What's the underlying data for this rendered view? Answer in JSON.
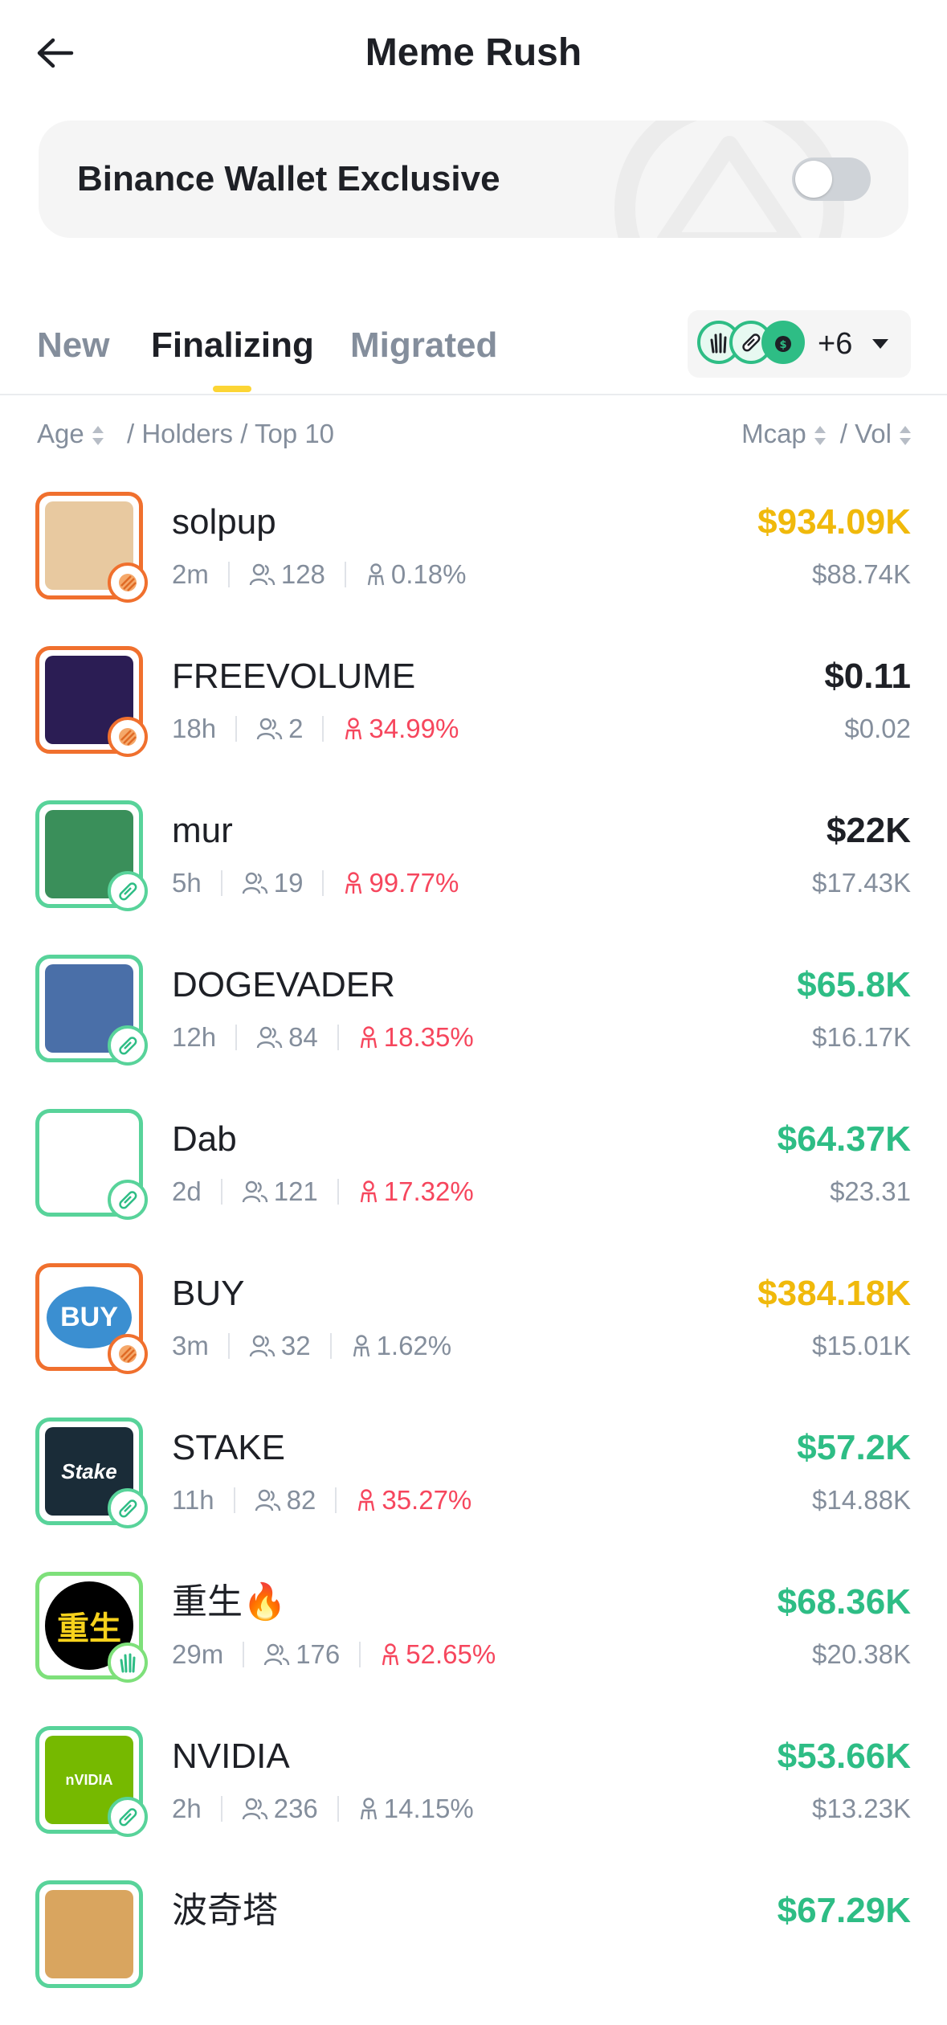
{
  "header": {
    "title": "Meme Rush",
    "back_icon": "arrow-left-icon"
  },
  "exclusive": {
    "label": "Binance Wallet Exclusive",
    "toggle_on": false
  },
  "tabs": [
    {
      "label": "New",
      "active": false
    },
    {
      "label": "Finalizing",
      "active": true
    },
    {
      "label": "Migrated",
      "active": false
    }
  ],
  "filter": {
    "icons": [
      "wave-hand-icon",
      "pill-icon",
      "money-bag-icon"
    ],
    "extra_count": "+6"
  },
  "columns": {
    "age": "Age",
    "holders": "/ Holders / Top 10",
    "mcap": "Mcap",
    "vol": "/ Vol"
  },
  "colors": {
    "accent_yellow": "#fcd535",
    "green": "#2ebd85",
    "gold": "#f0b90b",
    "red": "#f6465d",
    "orange_frame": "#f0702e",
    "green_frame": "#58d39a",
    "lime_frame": "#7ee07a"
  },
  "tokens": [
    {
      "name": "solpup",
      "age": "2m",
      "holders": "128",
      "top10": "0.18%",
      "top10_red": false,
      "mcap": "$934.09K",
      "mcap_color": "#f0b90b",
      "vol": "$88.74K",
      "frame": "orange",
      "badge": "stripes-icon",
      "avatar_icon": "dog-avatar-icon",
      "avatar_bg": "#e8c9a0"
    },
    {
      "name": "FREEVOLUME",
      "age": "18h",
      "holders": "2",
      "top10": "34.99%",
      "top10_red": true,
      "mcap": "$0.11",
      "mcap_color": "#1e2026",
      "vol": "$0.02",
      "frame": "orange",
      "badge": "stripes-icon",
      "avatar_icon": "coin-avatar-icon",
      "avatar_bg": "#2b1d54"
    },
    {
      "name": "mur",
      "age": "5h",
      "holders": "19",
      "top10": "99.77%",
      "top10_red": true,
      "mcap": "$22K",
      "mcap_color": "#1e2026",
      "vol": "$17.43K",
      "frame": "green",
      "badge": "pill-icon",
      "avatar_icon": "cat-avatar-icon",
      "avatar_bg": "#3a8f5a"
    },
    {
      "name": "DOGEVADER",
      "age": "12h",
      "holders": "84",
      "top10": "18.35%",
      "top10_red": true,
      "mcap": "$65.8K",
      "mcap_color": "#2ebd85",
      "vol": "$16.17K",
      "frame": "green",
      "badge": "pill-icon",
      "avatar_icon": "saber-avatar-icon",
      "avatar_bg": "#4a6fa8"
    },
    {
      "name": "Dab",
      "age": "2d",
      "holders": "121",
      "top10": "17.32%",
      "top10_red": true,
      "mcap": "$64.37K",
      "mcap_color": "#2ebd85",
      "vol": "$23.31",
      "frame": "green",
      "badge": "pill-icon",
      "avatar_icon": "dab-avatar-icon",
      "avatar_bg": "#ffffff"
    },
    {
      "name": "BUY",
      "age": "3m",
      "holders": "32",
      "top10": "1.62%",
      "top10_red": false,
      "mcap": "$384.18K",
      "mcap_color": "#f0b90b",
      "vol": "$15.01K",
      "frame": "orange",
      "badge": "stripes-icon",
      "avatar_icon": "buy-button-avatar-icon",
      "avatar_bg": "#ffffff",
      "avatar_text": "BUY"
    },
    {
      "name": "STAKE",
      "age": "11h",
      "holders": "82",
      "top10": "35.27%",
      "top10_red": true,
      "mcap": "$57.2K",
      "mcap_color": "#2ebd85",
      "vol": "$14.88K",
      "frame": "green",
      "badge": "pill-icon",
      "avatar_icon": "stake-logo-avatar-icon",
      "avatar_bg": "#1a2c38",
      "avatar_text": "Stake"
    },
    {
      "name": "重生🔥",
      "age": "29m",
      "holders": "176",
      "top10": "52.65%",
      "top10_red": true,
      "mcap": "$68.36K",
      "mcap_color": "#2ebd85",
      "vol": "$20.38K",
      "frame": "lime",
      "badge": "wave-hand-icon",
      "avatar_icon": "rebirth-avatar-icon",
      "avatar_bg": "#000000",
      "avatar_text": "重生"
    },
    {
      "name": "NVIDIA",
      "age": "2h",
      "holders": "236",
      "top10": "14.15%",
      "top10_red": false,
      "mcap": "$53.66K",
      "mcap_color": "#2ebd85",
      "vol": "$13.23K",
      "frame": "green",
      "badge": "pill-icon",
      "avatar_icon": "nvidia-logo-avatar-icon",
      "avatar_bg": "#76b900",
      "avatar_text": "nVIDIA"
    },
    {
      "name": "波奇塔",
      "age": "",
      "holders": "",
      "top10": "",
      "top10_red": false,
      "mcap": "$67.29K",
      "mcap_color": "#2ebd85",
      "vol": "",
      "frame": "green",
      "badge": "",
      "avatar_icon": "dog-avatar-icon",
      "avatar_bg": "#d9a55f"
    }
  ]
}
